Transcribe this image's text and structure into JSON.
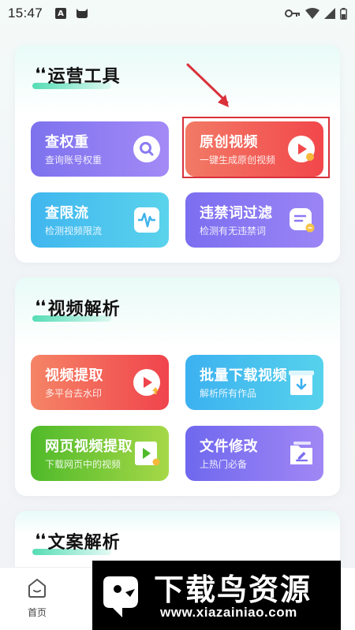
{
  "status_bar": {
    "time": "15:47",
    "notification_letter": "A",
    "icons": [
      "notification-a-icon",
      "cat-icon",
      "key-icon",
      "wifi-icon",
      "signal-icon",
      "battery-icon"
    ]
  },
  "sections": {
    "ops": {
      "title": "运营工具",
      "tools": [
        {
          "title": "查权重",
          "subtitle": "查询账号权重",
          "icon": "search-icon",
          "color": "#8a7cf1"
        },
        {
          "title": "原创视频",
          "subtitle": "一键生成原创视频",
          "icon": "play-icon",
          "color": "#f25a55"
        },
        {
          "title": "查限流",
          "subtitle": "检测视频限流",
          "icon": "waveform-icon",
          "color": "#4bc3ee"
        },
        {
          "title": "违禁词过滤",
          "subtitle": "检测有无违禁词",
          "icon": "document-filter-icon",
          "color": "#8a79f2"
        }
      ]
    },
    "video": {
      "title": "视频解析",
      "tools": [
        {
          "title": "视频提取",
          "subtitle": "多平台去水印",
          "icon": "play-upload-icon",
          "color": "#f25f58"
        },
        {
          "title": "批量下载视频",
          "subtitle": "解析所有作品",
          "icon": "download-box-icon",
          "color": "#48c0ee"
        },
        {
          "title": "网页视频提取",
          "subtitle": "下载网页中的视频",
          "icon": "video-file-icon",
          "color": "#78c83a"
        },
        {
          "title": "文件修改",
          "subtitle": "上热门必备",
          "icon": "edit-folder-icon",
          "color": "#8777f2"
        }
      ]
    },
    "text": {
      "title": "文案解析"
    }
  },
  "bottom_nav": {
    "home_label": "首页"
  },
  "watermark": {
    "main": "下载鸟资源",
    "url": "www.xiazainiao.com"
  }
}
